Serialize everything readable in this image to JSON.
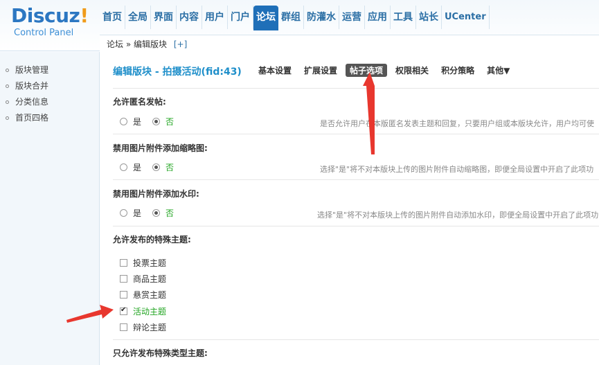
{
  "logo": {
    "brand": "Discuz",
    "exclaim": "!",
    "sub": "Control Panel"
  },
  "topnav": [
    "首页",
    "全局",
    "界面",
    "内容",
    "用户",
    "门户",
    "论坛",
    "群组",
    "防灌水",
    "运营",
    "应用",
    "工具",
    "站长",
    "UCenter"
  ],
  "topnav_active": "论坛",
  "breadcrumb": {
    "root": "论坛",
    "sep": "»",
    "current": "编辑版块",
    "plus": "[+]"
  },
  "sidebar": [
    "版块管理",
    "版块合并",
    "分类信息",
    "首页四格"
  ],
  "page": {
    "title": "编辑版块 - 拍摄活动(fid:43)"
  },
  "subnav": [
    "基本设置",
    "扩展设置",
    "帖子选项",
    "权限相关",
    "积分策略",
    "其他▼"
  ],
  "subnav_active": "帖子选项",
  "options": [
    {
      "title": "允许匿名发帖:",
      "yes": "是",
      "no": "否",
      "value": "否",
      "hint": "是否允许用户在本版匿名发表主题和回复，只要用户组或本版块允许，用户均可使"
    },
    {
      "title": "禁用图片附件添加缩略图:",
      "yes": "是",
      "no": "否",
      "value": "否",
      "hint": "选择\"是\"将不对本版块上传的图片附件自动缩略图，即便全局设置中开启了此项功"
    },
    {
      "title": "禁用图片附件添加水印:",
      "yes": "是",
      "no": "否",
      "value": "否",
      "hint": "选择\"是\"将不对本版块上传的图片附件自动添加水印，即便全局设置中开启了此项功"
    }
  ],
  "special": {
    "title": "允许发布的特殊主题:",
    "items": [
      {
        "label": "投票主题",
        "checked": false
      },
      {
        "label": "商品主题",
        "checked": false
      },
      {
        "label": "悬赏主题",
        "checked": false
      },
      {
        "label": "活动主题",
        "checked": true
      },
      {
        "label": "辩论主题",
        "checked": false
      }
    ]
  },
  "only_special": {
    "title": "只允许发布特殊类型主题:"
  },
  "colors": {
    "accent": "#1f6fb8",
    "title": "#1f8fca",
    "green": "#22a522",
    "arrow": "#e8372e"
  }
}
